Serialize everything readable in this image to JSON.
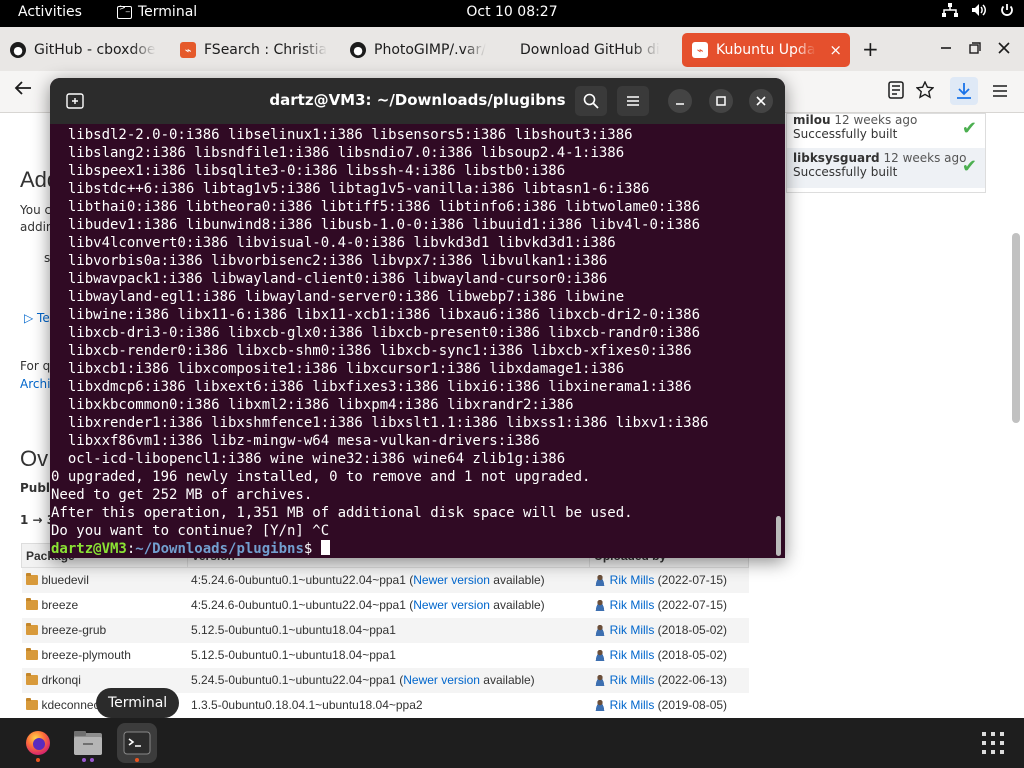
{
  "topbar": {
    "activities": "Activities",
    "app_name": "Terminal",
    "clock": "Oct 10  08:27",
    "icons": [
      "network-icon",
      "volume-icon",
      "power-icon"
    ]
  },
  "browser": {
    "tabs": [
      {
        "label": "GitHub - cboxdoe",
        "icon": "github-icon"
      },
      {
        "label": "FSearch : Christia",
        "icon": "launchpad-icon"
      },
      {
        "label": "PhotoGIMP/.var/",
        "icon": "github-icon"
      },
      {
        "label": "Download GitHub di",
        "icon": "none"
      },
      {
        "label": "Kubuntu Update",
        "icon": "launchpad-icon",
        "active": true
      }
    ],
    "new_tab": "+",
    "close_tab": "×"
  },
  "page": {
    "heading_add": "Add",
    "para_line1": "You c",
    "para_line2": "addin",
    "para_frag": "s",
    "tech_toggle": "Te",
    "for_q": "For q",
    "archi_link": "Archi",
    "heading_ov": "Ov",
    "publi": "Publi",
    "range": "1 → 3",
    "builds": [
      {
        "package": "milou",
        "ago": "12 weeks ago",
        "status": "Successfully built"
      },
      {
        "package": "libksysguard",
        "ago": "12 weeks ago",
        "status": "Successfully built"
      }
    ],
    "table": {
      "headers": [
        "Package",
        "Version",
        "Uploaded by"
      ],
      "rows": [
        {
          "package": "bluedevil",
          "version": "4:5.24.6-0ubuntu0.1~ubuntu22.04~ppa1",
          "newer": true,
          "uploader": "Rik Mills",
          "date": "(2022-07-15)"
        },
        {
          "package": "breeze",
          "version": "4:5.24.6-0ubuntu0.1~ubuntu22.04~ppa1",
          "newer": true,
          "uploader": "Rik Mills",
          "date": "(2022-07-15)"
        },
        {
          "package": "breeze-grub",
          "version": "5.12.5-0ubuntu0.1~ubuntu18.04~ppa1",
          "newer": false,
          "uploader": "Rik Mills",
          "date": "(2018-05-02)"
        },
        {
          "package": "breeze-plymouth",
          "version": "5.12.5-0ubuntu0.1~ubuntu18.04~ppa1",
          "newer": false,
          "uploader": "Rik Mills",
          "date": "(2018-05-02)"
        },
        {
          "package": "drkonqi",
          "version": "5.24.5-0ubuntu0.1~ubuntu22.04~ppa1",
          "newer": true,
          "uploader": "Rik Mills",
          "date": "(2022-06-13)"
        },
        {
          "package": "kdeconnect",
          "version": "1.3.5-0ubuntu0.18.04.1~ubuntu18.04~ppa2",
          "newer": false,
          "uploader": "Rik Mills",
          "date": "(2019-08-05)"
        }
      ],
      "newer_open": "(",
      "newer_link": "Newer version",
      "newer_close": " available)"
    }
  },
  "terminal": {
    "title": "dartz@VM3: ~/Downloads/plugibns",
    "lines": [
      "  libsdl2-2.0-0:i386 libselinux1:i386 libsensors5:i386 libshout3:i386",
      "  libslang2:i386 libsndfile1:i386 libsndio7.0:i386 libsoup2.4-1:i386",
      "  libspeex1:i386 libsqlite3-0:i386 libssh-4:i386 libstb0:i386",
      "  libstdc++6:i386 libtag1v5:i386 libtag1v5-vanilla:i386 libtasn1-6:i386",
      "  libthai0:i386 libtheora0:i386 libtiff5:i386 libtinfo6:i386 libtwolame0:i386",
      "  libudev1:i386 libunwind8:i386 libusb-1.0-0:i386 libuuid1:i386 libv4l-0:i386",
      "  libv4lconvert0:i386 libvisual-0.4-0:i386 libvkd3d1 libvkd3d1:i386",
      "  libvorbis0a:i386 libvorbisenc2:i386 libvpx7:i386 libvulkan1:i386",
      "  libwavpack1:i386 libwayland-client0:i386 libwayland-cursor0:i386",
      "  libwayland-egl1:i386 libwayland-server0:i386 libwebp7:i386 libwine",
      "  libwine:i386 libx11-6:i386 libx11-xcb1:i386 libxau6:i386 libxcb-dri2-0:i386",
      "  libxcb-dri3-0:i386 libxcb-glx0:i386 libxcb-present0:i386 libxcb-randr0:i386",
      "  libxcb-render0:i386 libxcb-shm0:i386 libxcb-sync1:i386 libxcb-xfixes0:i386",
      "  libxcb1:i386 libxcomposite1:i386 libxcursor1:i386 libxdamage1:i386",
      "  libxdmcp6:i386 libxext6:i386 libxfixes3:i386 libxi6:i386 libxinerama1:i386",
      "  libxkbcommon0:i386 libxml2:i386 libxpm4:i386 libxrandr2:i386",
      "  libxrender1:i386 libxshmfence1:i386 libxslt1.1:i386 libxss1:i386 libxv1:i386",
      "  libxxf86vm1:i386 libz-mingw-w64 mesa-vulkan-drivers:i386",
      "  ocl-icd-libopencl1:i386 wine wine32:i386 wine64 zlib1g:i386",
      "0 upgraded, 196 newly installed, 0 to remove and 1 not upgraded.",
      "Need to get 252 MB of archives.",
      "After this operation, 1,351 MB of additional disk space will be used.",
      "Do you want to continue? [Y/n] ^C"
    ],
    "prompt_user": "dartz@VM3",
    "prompt_sep": ":",
    "prompt_path": "~/Downloads/plugibns",
    "prompt_end": "$ "
  },
  "dock": {
    "tooltip": "Terminal",
    "items": [
      "firefox-icon",
      "files-icon",
      "terminal-icon"
    ],
    "apps_grid": "show-apps-icon"
  }
}
